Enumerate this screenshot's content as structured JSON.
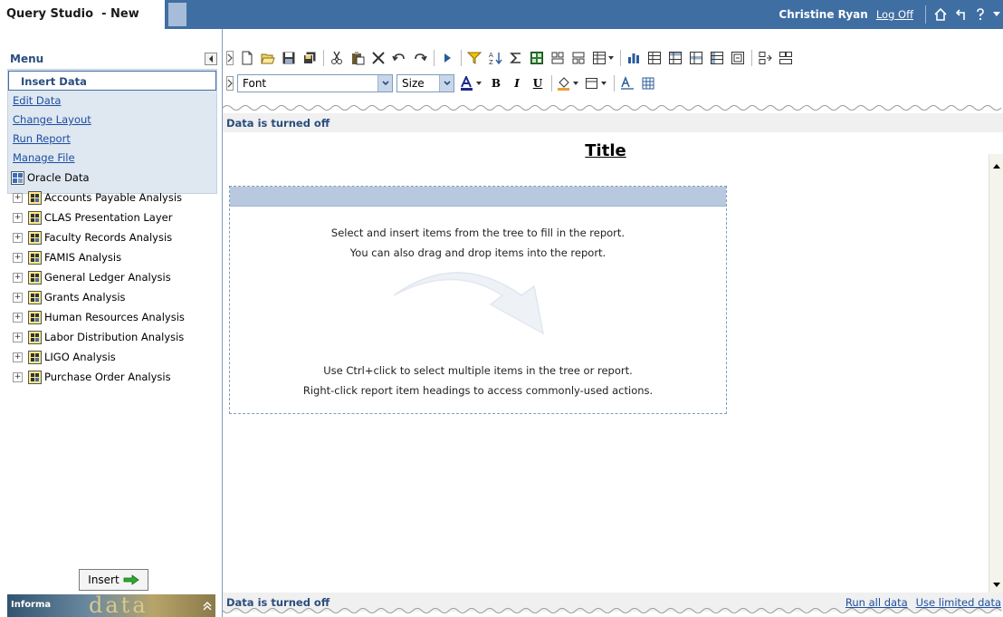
{
  "header": {
    "app_title": "Query Studio  - New",
    "user_name": "Christine Ryan",
    "logoff": "Log Off"
  },
  "menu": {
    "title": "Menu",
    "items": [
      {
        "label": "Insert Data",
        "active": true
      },
      {
        "label": "Edit Data"
      },
      {
        "label": "Change Layout"
      },
      {
        "label": "Run Report"
      },
      {
        "label": "Manage File"
      }
    ]
  },
  "tree": {
    "root": "Oracle Data",
    "items": [
      "Accounts Payable Analysis",
      "CLAS Presentation Layer",
      "Faculty Records Analysis",
      "FAMIS Analysis",
      "General Ledger Analysis",
      "Grants Analysis",
      "Human Resources Analysis",
      "Labor Distribution Analysis",
      "LIGO Analysis",
      "Purchase Order Analysis"
    ]
  },
  "left_footer": {
    "insert_label": "Insert",
    "info_label": "Informa",
    "info_word": "data"
  },
  "format_toolbar": {
    "font_value": "Font",
    "size_value": "Size",
    "bold": "B",
    "italic": "I",
    "underline": "U"
  },
  "report": {
    "status_top": "Data is turned off",
    "status_bottom": "Data is turned off",
    "title": "Title",
    "hint_line1": "Select and insert items from the tree to fill in the report.",
    "hint_line2": "You can also drag and drop items into the report.",
    "hint_line3": "Use Ctrl+click to select multiple items in the tree or report.",
    "hint_line4": "Right-click report item headings to access commonly-used actions.",
    "run_all": "Run all data",
    "use_limited": "Use limited data"
  },
  "colors": {
    "header_bg": "#3f6ea3",
    "menu_bg": "#dfe7f1",
    "link": "#1c4fa0",
    "heading": "#294e7e"
  }
}
